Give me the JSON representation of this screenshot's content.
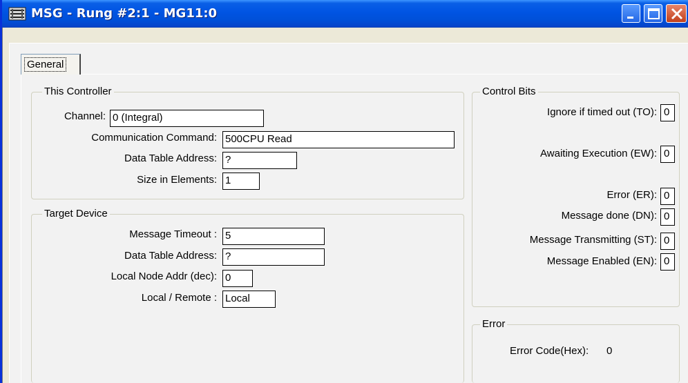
{
  "window": {
    "title": "MSG - Rung #2:1 - MG11:0"
  },
  "tabs": [
    {
      "label": "General"
    }
  ],
  "this_controller": {
    "title": "This Controller",
    "channel": {
      "label": "Channel:",
      "value": "0 (Integral)"
    },
    "command": {
      "label": "Communication Command:",
      "value": "500CPU Read"
    },
    "data_table": {
      "label": "Data Table Address:",
      "value": "?"
    },
    "size": {
      "label": "Size in Elements:",
      "value": "1"
    }
  },
  "target_device": {
    "title": "Target Device",
    "timeout": {
      "label": "Message Timeout :",
      "value": "5"
    },
    "data_table": {
      "label": "Data Table Address:",
      "value": "?"
    },
    "node": {
      "label": "Local Node Addr (dec):",
      "value": "0"
    },
    "local_remote": {
      "label": "Local / Remote :",
      "value": "Local"
    }
  },
  "control_bits": {
    "title": "Control Bits",
    "to": {
      "label": "Ignore if timed out (TO):",
      "value": "0"
    },
    "ew": {
      "label": "Awaiting Execution (EW):",
      "value": "0"
    },
    "er": {
      "label": "Error (ER):",
      "value": "0"
    },
    "dn": {
      "label": "Message done (DN):",
      "value": "0"
    },
    "st": {
      "label": "Message Transmitting (ST):",
      "value": "0"
    },
    "en": {
      "label": "Message Enabled (EN):",
      "value": "0"
    }
  },
  "error": {
    "title": "Error",
    "code_label": "Error Code(Hex):",
    "code_value": "0"
  },
  "colors": {
    "titlebar": "#0054e3",
    "close_button": "#c1401c",
    "face": "#ece9d8"
  }
}
